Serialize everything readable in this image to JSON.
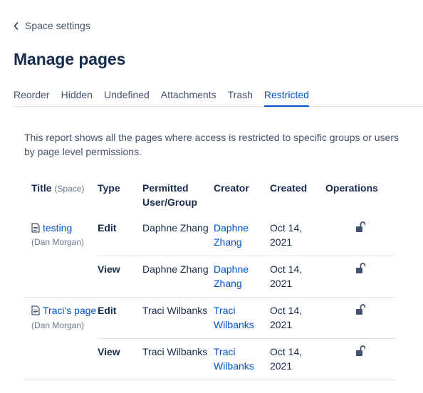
{
  "nav": {
    "back_label": "Space settings"
  },
  "page": {
    "title": "Manage pages"
  },
  "tabs": [
    {
      "label": "Reorder",
      "active": false
    },
    {
      "label": "Hidden",
      "active": false
    },
    {
      "label": "Undefined",
      "active": false
    },
    {
      "label": "Attachments",
      "active": false
    },
    {
      "label": "Trash",
      "active": false
    },
    {
      "label": "Restricted",
      "active": true
    }
  ],
  "report": {
    "description": "This report shows all the pages where access is restricted to specific groups or users by page level permissions."
  },
  "table": {
    "headers": {
      "title": "Title",
      "title_hint": "(Space)",
      "type": "Type",
      "permitted": "Permitted User/Group",
      "creator": "Creator",
      "created": "Created",
      "operations": "Operations"
    },
    "pages": [
      {
        "title": "testing",
        "space": "(Dan Morgan)",
        "restrictions": [
          {
            "type": "Edit",
            "permitted": "Daphne Zhang",
            "creator": "Daphne Zhang",
            "created": "Oct 14, 2021",
            "operation_icon": "unlock-icon"
          },
          {
            "type": "View",
            "permitted": "Daphne Zhang",
            "creator": "Daphne Zhang",
            "created": "Oct 14, 2021",
            "operation_icon": "unlock-icon"
          }
        ]
      },
      {
        "title": "Traci's page",
        "space": "(Dan Morgan)",
        "restrictions": [
          {
            "type": "Edit",
            "permitted": "Traci Wilbanks",
            "creator": "Traci Wilbanks",
            "created": "Oct 14, 2021",
            "operation_icon": "unlock-icon"
          },
          {
            "type": "View",
            "permitted": "Traci Wilbanks",
            "creator": "Traci Wilbanks",
            "created": "Oct 14, 2021",
            "operation_icon": "unlock-icon"
          }
        ]
      }
    ]
  },
  "colors": {
    "link": "#0052cc",
    "text": "#172b4d",
    "subtle": "#42526e",
    "border": "#dfe1e6"
  }
}
